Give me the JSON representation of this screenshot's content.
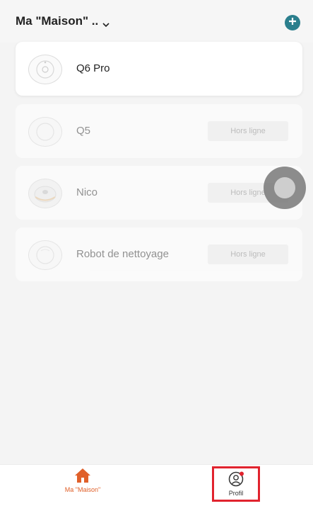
{
  "header": {
    "title": "Ma \"Maison\" ..",
    "dropdown_icon": "chevron-down-icon",
    "add_icon": "plus-circle-icon",
    "accent_color": "#2b7f8d"
  },
  "devices": [
    {
      "name": "Q6 Pro",
      "status": "",
      "online": true
    },
    {
      "name": "Q5",
      "status": "Hors ligne",
      "online": false
    },
    {
      "name": "Nico",
      "status": "Hors ligne",
      "online": false
    },
    {
      "name": "Robot de nettoyage",
      "status": "Hors ligne",
      "online": false
    }
  ],
  "tabbar": {
    "home_label": "Ma \"Maison\"",
    "home_icon": "home-icon",
    "home_color": "#e0602a",
    "profile_label": "Profil",
    "profile_icon": "user-icon",
    "highlight_color": "#e1232e"
  }
}
